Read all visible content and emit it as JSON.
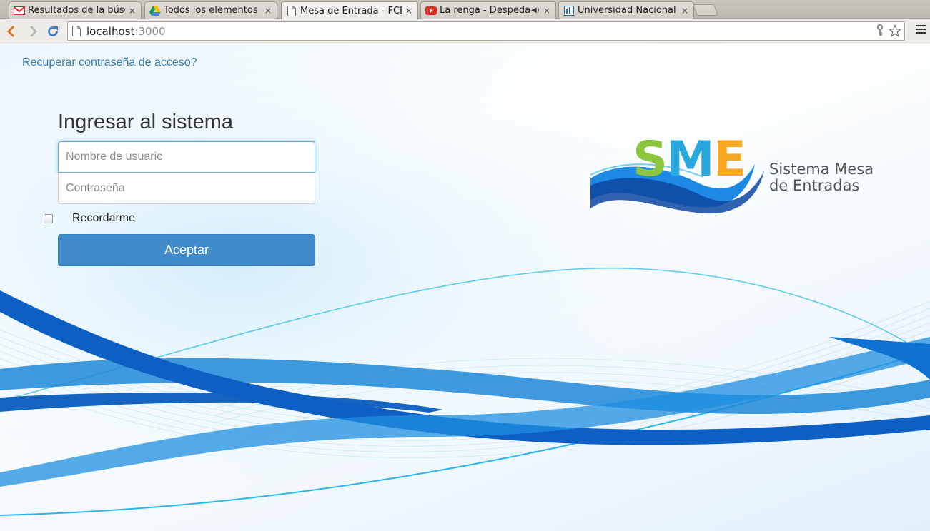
{
  "browser": {
    "tabs": [
      {
        "title": "Resultados de la búsq",
        "icon": "gmail-icon",
        "active": false
      },
      {
        "title": "Todos los elementos -",
        "icon": "drive-icon",
        "active": false
      },
      {
        "title": "Mesa de Entrada - FCE",
        "icon": "page-icon",
        "active": true
      },
      {
        "title": "La renga - Despedad",
        "icon": "youtube-icon",
        "active": false,
        "audio": true
      },
      {
        "title": "Universidad Nacional",
        "icon": "site-icon",
        "active": false
      }
    ],
    "close_glyph": "×",
    "audio_glyph": "◀)",
    "url_host": "localhost",
    "url_port": ":3000"
  },
  "page": {
    "recover_link": "Recuperar contraseña de acceso?",
    "form_title": "Ingresar al sistema",
    "username_placeholder": "Nombre de usuario",
    "password_placeholder": "Contraseña",
    "remember_label": "Recordarme",
    "submit_label": "Aceptar",
    "logo": {
      "letter_s": "S",
      "letter_m": "M",
      "letter_e": "E",
      "line1": "Sistema Mesa",
      "line2": "de Entradas",
      "colors": {
        "s": "#8cc63f",
        "m": "#29a8e0",
        "e": "#f7a823"
      }
    }
  },
  "colors": {
    "primary": "#428bca",
    "link": "#337ab7"
  }
}
